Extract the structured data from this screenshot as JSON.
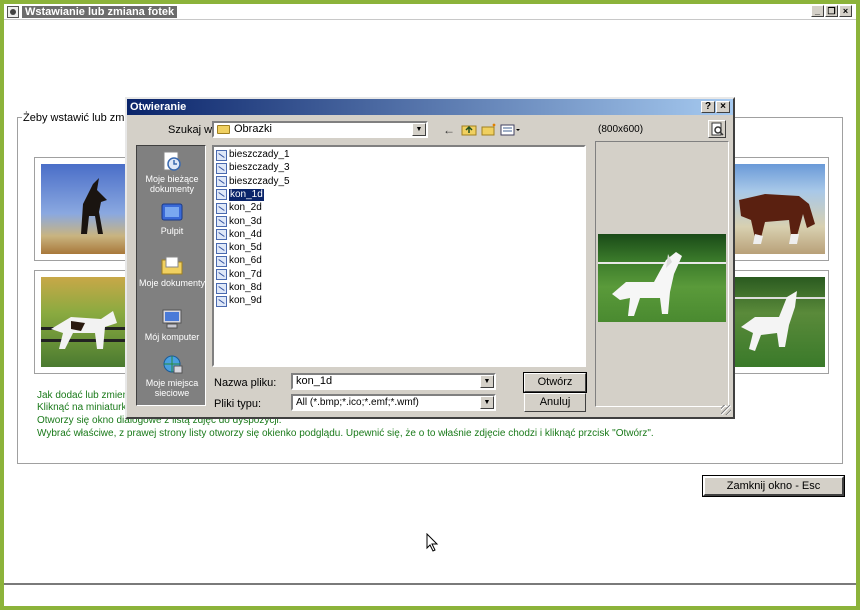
{
  "window": {
    "title": "Wstawianie lub zmiana fotek",
    "ctrl_min": "_",
    "ctrl_restore": "❒",
    "ctrl_close": "×"
  },
  "main": {
    "group_label": "Żeby wstawić lub zmienić",
    "help_lines": [
      "Jak dodać lub zmienić",
      "Kliknąć na miniaturkę lub",
      "Otworzy się okno dialogowe z listą zdjęć do dyspozycji.",
      "Wybrać właściwe, z prawej strony listy otworzy się okienko podglądu. Upewnić się, że o to właśnie zdjęcie chodzi i kliknąć przcisk \"Otwórz\"."
    ],
    "close_button": "Zamknij okno - Esc",
    "help_color": "#1a7a1a"
  },
  "dialog": {
    "title": "Otwieranie",
    "help_btn": "?",
    "close_btn": "×",
    "look_in_label": "Szukaj w:",
    "look_in_value": "Obrazki",
    "preview_size": "(800x600)",
    "places": [
      {
        "label": "Moje bieżące dokumenty",
        "icon": "recent-documents-icon"
      },
      {
        "label": "Pulpit",
        "icon": "desktop-icon"
      },
      {
        "label": "Moje dokumenty",
        "icon": "my-documents-icon"
      },
      {
        "label": "Mój komputer",
        "icon": "my-computer-icon"
      },
      {
        "label": "Moje miejsca sieciowe",
        "icon": "network-places-icon"
      }
    ],
    "files": [
      "bieszczady_1",
      "bieszczady_3",
      "bieszczady_5",
      "kon_1d",
      "kon_2d",
      "kon_3d",
      "kon_4d",
      "kon_5d",
      "kon_6d",
      "kon_7d",
      "kon_8d",
      "kon_9d"
    ],
    "selected_file": "kon_1d",
    "filename_label": "Nazwa pliku:",
    "filename_value": "kon_1d",
    "filetype_label": "Pliki typu:",
    "filetype_value": "All (*.bmp;*.ico;*.emf;*.wmf)",
    "open_button": "Otwórz",
    "cancel_button": "Anuluj",
    "title_color": "#0a246a"
  }
}
